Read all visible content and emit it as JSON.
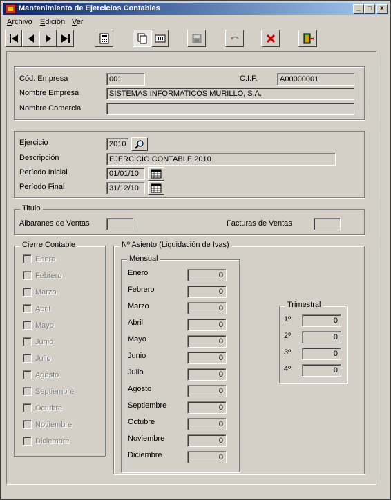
{
  "window": {
    "title": "Mantenimiento de Ejercicios Contables"
  },
  "titlebar_buttons": {
    "minimize": "_",
    "maximize": "□",
    "close": "X"
  },
  "menu": {
    "archivo": {
      "first": "A",
      "rest": "rchivo"
    },
    "edicion": {
      "first": "E",
      "rest": "dición"
    },
    "ver": {
      "first": "V",
      "rest": "er"
    }
  },
  "toolbar": {
    "icons": [
      "first-record-icon",
      "previous-record-icon",
      "next-record-icon",
      "last-record-icon",
      "calculator-icon",
      "copy-icon",
      "edit-icon",
      "save-icon",
      "undo-icon",
      "delete-icon",
      "exit-icon"
    ]
  },
  "empresa": {
    "cod_label": "Cód. Empresa",
    "cod_value": "001",
    "cif_label": "C.I.F.",
    "cif_value": "A00000001",
    "nombre_label": "Nombre Empresa",
    "nombre_value": "SISTEMAS INFORMATICOS MURILLO, S.A.",
    "comercial_label": "Nombre Comercial",
    "comercial_value": ""
  },
  "ejercicio": {
    "ejercicio_label": "Ejercicio",
    "ejercicio_value": "2010",
    "descripcion_label": "Descripción",
    "descripcion_value": "EJERCICIO CONTABLE 2010",
    "inicial_label": "Período Inicial",
    "inicial_value": "01/01/10",
    "final_label": "Período Final",
    "final_value": "31/12/10"
  },
  "titulo": {
    "title": "Titulo",
    "albaranes_label": "Albaranes de Ventas",
    "albaranes_value": "",
    "facturas_label": "Facturas de Ventas",
    "facturas_value": ""
  },
  "cierre": {
    "title": "Cierre Contable",
    "months": [
      "Enero",
      "Febrero",
      "Marzo",
      "Abril",
      "Mayo",
      "Junio",
      "Julio",
      "Agosto",
      "Septiembre",
      "Octubre",
      "Noviembre",
      "Diciembre"
    ]
  },
  "asiento": {
    "title": "Nº Asiento (Liquidación de Ivas)",
    "mensual_title": "Mensual",
    "mensual": [
      {
        "label": "Enero",
        "value": "0"
      },
      {
        "label": "Febrero",
        "value": "0"
      },
      {
        "label": "Marzo",
        "value": "0"
      },
      {
        "label": "Abril",
        "value": "0"
      },
      {
        "label": "Mayo",
        "value": "0"
      },
      {
        "label": "Junio",
        "value": "0"
      },
      {
        "label": "Julio",
        "value": "0"
      },
      {
        "label": "Agosto",
        "value": "0"
      },
      {
        "label": "Septiembre",
        "value": "0"
      },
      {
        "label": "Octubre",
        "value": "0"
      },
      {
        "label": "Noviembre",
        "value": "0"
      },
      {
        "label": "Diciembre",
        "value": "0"
      }
    ],
    "trimestral_title": "Trimestral",
    "trimestral": [
      {
        "label": "1º",
        "value": "0"
      },
      {
        "label": "2º",
        "value": "0"
      },
      {
        "label": "3º",
        "value": "0"
      },
      {
        "label": "4º",
        "value": "0"
      }
    ]
  }
}
